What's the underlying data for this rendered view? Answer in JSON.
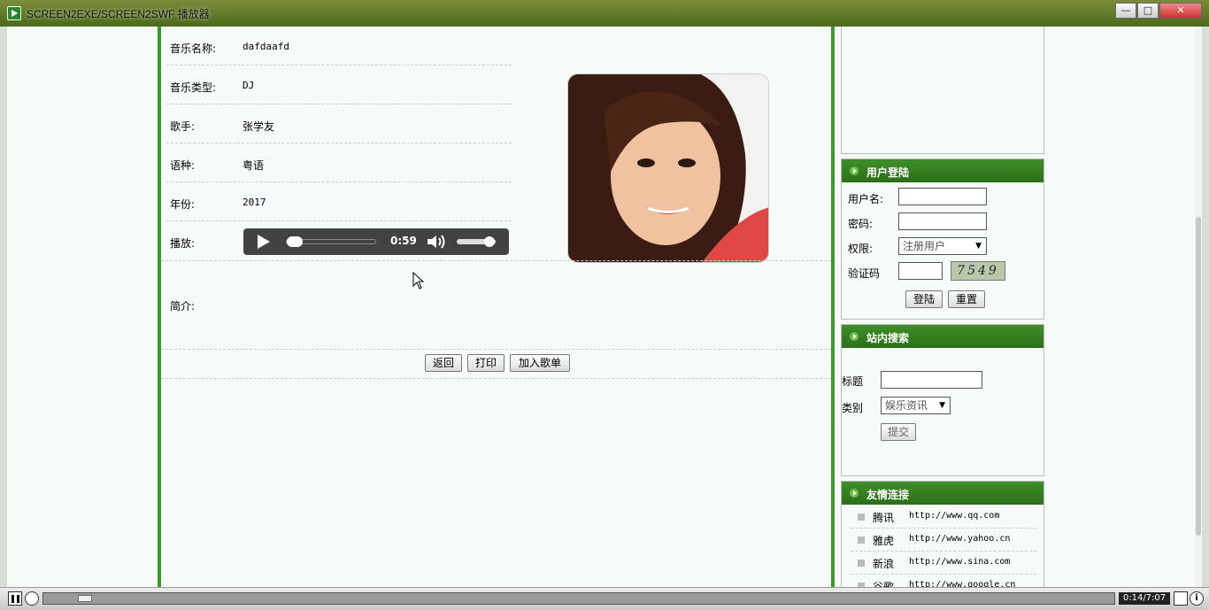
{
  "window": {
    "title": "SCREEN2EXE/SCREEN2SWF 播放器",
    "minimize": "—",
    "maximize": "□",
    "close": "✕"
  },
  "details": {
    "rows": [
      {
        "label": "音乐名称:",
        "value": "dafdaafd"
      },
      {
        "label": "音乐类型:",
        "value": "DJ"
      },
      {
        "label": "歌手:",
        "value": "张学友"
      },
      {
        "label": "语种:",
        "value": "粤语"
      },
      {
        "label": "年份:",
        "value": "2017"
      },
      {
        "label": "播放:",
        "value": ""
      }
    ],
    "intro_label": "简介:",
    "intro_value": ""
  },
  "audio_player": {
    "time": "0:59",
    "progress_fraction": 0.02,
    "volume_fraction": 0.85
  },
  "actions": {
    "back": "返回",
    "print": "打印",
    "add_playlist": "加入歌单"
  },
  "login": {
    "header": "用户登陆",
    "username_label": "用户名:",
    "username_value": "",
    "password_label": "密码:",
    "password_value": "",
    "role_label": "权限:",
    "role_value": "注册用户",
    "captcha_label": "验证码",
    "captcha_value": "",
    "captcha_text": "7549",
    "login_button": "登陆",
    "reset_button": "重置"
  },
  "search": {
    "header": "站内搜索",
    "title_label": "标题",
    "title_value": "",
    "category_label": "类别",
    "category_value": "娱乐资讯",
    "submit_button": "提交"
  },
  "links": {
    "header": "友情连接",
    "items": [
      {
        "name": "腾讯",
        "url": "http://www.qq.com"
      },
      {
        "name": "雅虎",
        "url": "http://www.yahoo.cn"
      },
      {
        "name": "新浪",
        "url": "http://www.sina.com"
      },
      {
        "name": "谷歌",
        "url": "http://www.google.cn"
      }
    ]
  },
  "video_player": {
    "time": "0:14/7:07",
    "progress_fraction": 0.033,
    "info": "i"
  },
  "colors": {
    "accent_green": "#3a9a2a",
    "header_green": "#2c6e18",
    "audio_bg": "#424242"
  }
}
